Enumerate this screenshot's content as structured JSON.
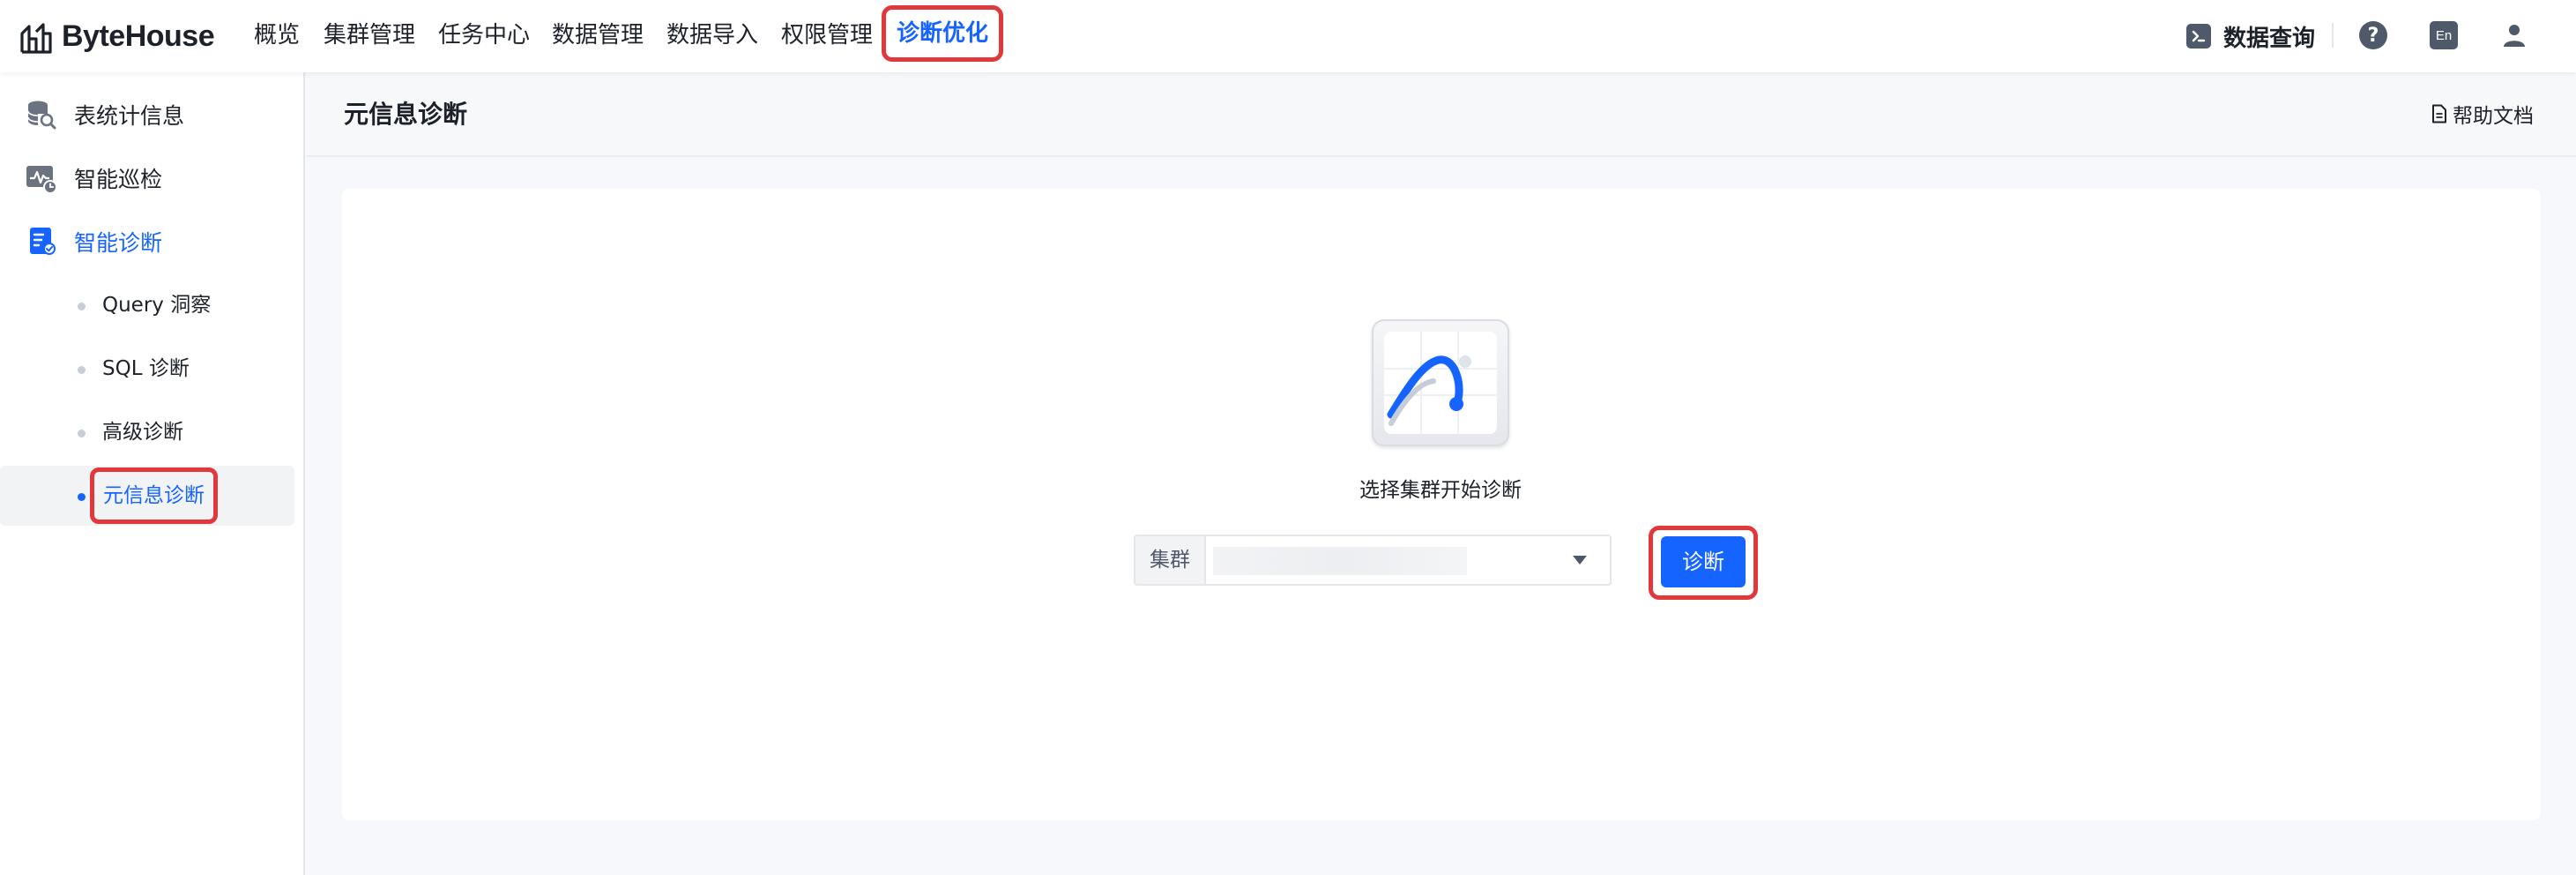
{
  "brand": {
    "name": "ByteHouse"
  },
  "nav": {
    "items": [
      {
        "label": "概览"
      },
      {
        "label": "集群管理"
      },
      {
        "label": "任务中心"
      },
      {
        "label": "数据管理"
      },
      {
        "label": "数据导入"
      },
      {
        "label": "权限管理"
      },
      {
        "label": "诊断优化"
      }
    ],
    "active_index": 6
  },
  "topright": {
    "query_label": "数据查询",
    "help_glyph": "?",
    "lang_label": "En",
    "icons": [
      "terminal-icon",
      "help-icon",
      "language-icon",
      "user-icon"
    ]
  },
  "sidebar": {
    "items": [
      {
        "label": "表统计信息",
        "icon": "database-search-icon"
      },
      {
        "label": "智能巡检",
        "icon": "monitor-pulse-icon"
      },
      {
        "label": "智能诊断",
        "icon": "diagnosis-doc-icon"
      }
    ],
    "subitems": [
      {
        "label": "Query 洞察"
      },
      {
        "label": "SQL 诊断"
      },
      {
        "label": "高级诊断"
      },
      {
        "label": "元信息诊断"
      }
    ],
    "selected_subitem": 3
  },
  "header": {
    "title": "元信息诊断",
    "help_doc": "帮助文档"
  },
  "main": {
    "prompt": "选择集群开始诊断",
    "cluster_prefix": "集群",
    "cluster_value": "",
    "diagnose_button": "诊断"
  },
  "colors": {
    "accent": "#1664ff",
    "highlight": "#e2383c",
    "text": "#1d2129",
    "muted": "#4e5969"
  }
}
